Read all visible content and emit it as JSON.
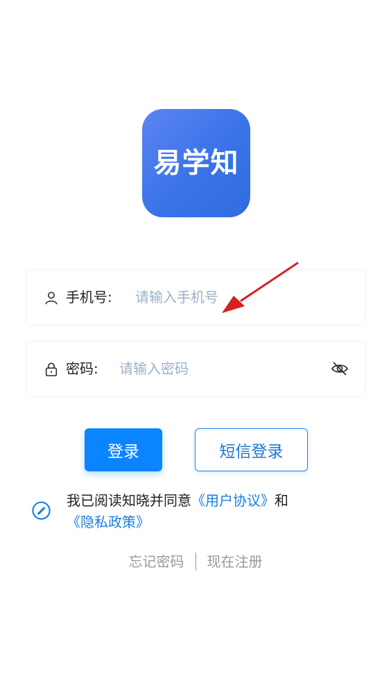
{
  "app": {
    "logo_text": "易学知",
    "logo_gradient_start": "#5c84f4",
    "logo_gradient_end": "#2f6ddf"
  },
  "phone_field": {
    "icon": "user-icon",
    "label": "手机号:",
    "placeholder": "请输入手机号",
    "value": ""
  },
  "password_field": {
    "icon": "lock-icon",
    "label": "密码:",
    "placeholder": "请输入密码",
    "value": "",
    "visibility_icon": "eye-off-icon"
  },
  "buttons": {
    "login_label": "登录",
    "sms_login_label": "短信登录"
  },
  "agreement": {
    "prefix": "我已阅读知晓并同意",
    "user_agreement": "《用户协议》",
    "conjunction": "和",
    "privacy_policy": "《隐私政策》",
    "checked": false
  },
  "bottom_links": {
    "forgot_password": "忘记密码",
    "register": "现在注册"
  },
  "colors": {
    "primary": "#0a84ff",
    "link": "#1a80e0",
    "placeholder": "#9ab0c9",
    "muted": "#999999",
    "annotation_arrow": "#d42020"
  }
}
